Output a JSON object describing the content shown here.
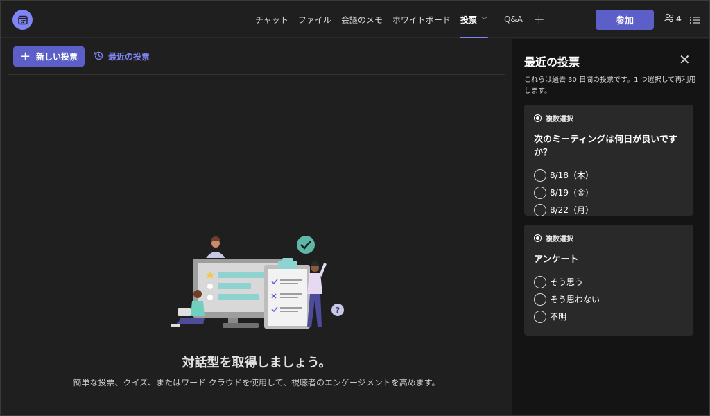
{
  "topbar": {
    "tabs": [
      {
        "label": "チャット"
      },
      {
        "label": "ファイル"
      },
      {
        "label": "会議のメモ"
      },
      {
        "label": "ホワイトボード"
      },
      {
        "label": "投票"
      },
      {
        "label": "Q&A"
      }
    ],
    "active_tab": "投票",
    "join_label": "参加",
    "participant_count": "4",
    "icons": [
      "calendar-icon",
      "chevron-down-icon",
      "add-tab-icon",
      "people-icon",
      "list-icon"
    ]
  },
  "toolbar": {
    "new_poll_label": "新しい投票",
    "recent_polls_label": "最近の投票"
  },
  "empty_state": {
    "title": "対話型を取得しましょう。",
    "description": "簡単な投票、クイズ、またはワード クラウドを使用して、視聴者のエンゲージメントを高めます。"
  },
  "recent_panel": {
    "title": "最近の投票",
    "description": "これらは過去 30 日間の投票です。1 つ選択して再利用します。",
    "polls": [
      {
        "type": "複数選択",
        "question": "次のミーティングは何日が良いですか？",
        "options": [
          "8/18（木）",
          "8/19（金）",
          "8/22（月）"
        ]
      },
      {
        "type": "複数選択",
        "question": "アンケート",
        "options": [
          "そう思う",
          "そう思わない",
          "不明"
        ]
      }
    ]
  },
  "colors": {
    "accent": "#5b5fc7",
    "accent_light": "#7f85f5",
    "background": "#1f1f1f",
    "panel": "#141414",
    "card": "#292929"
  }
}
